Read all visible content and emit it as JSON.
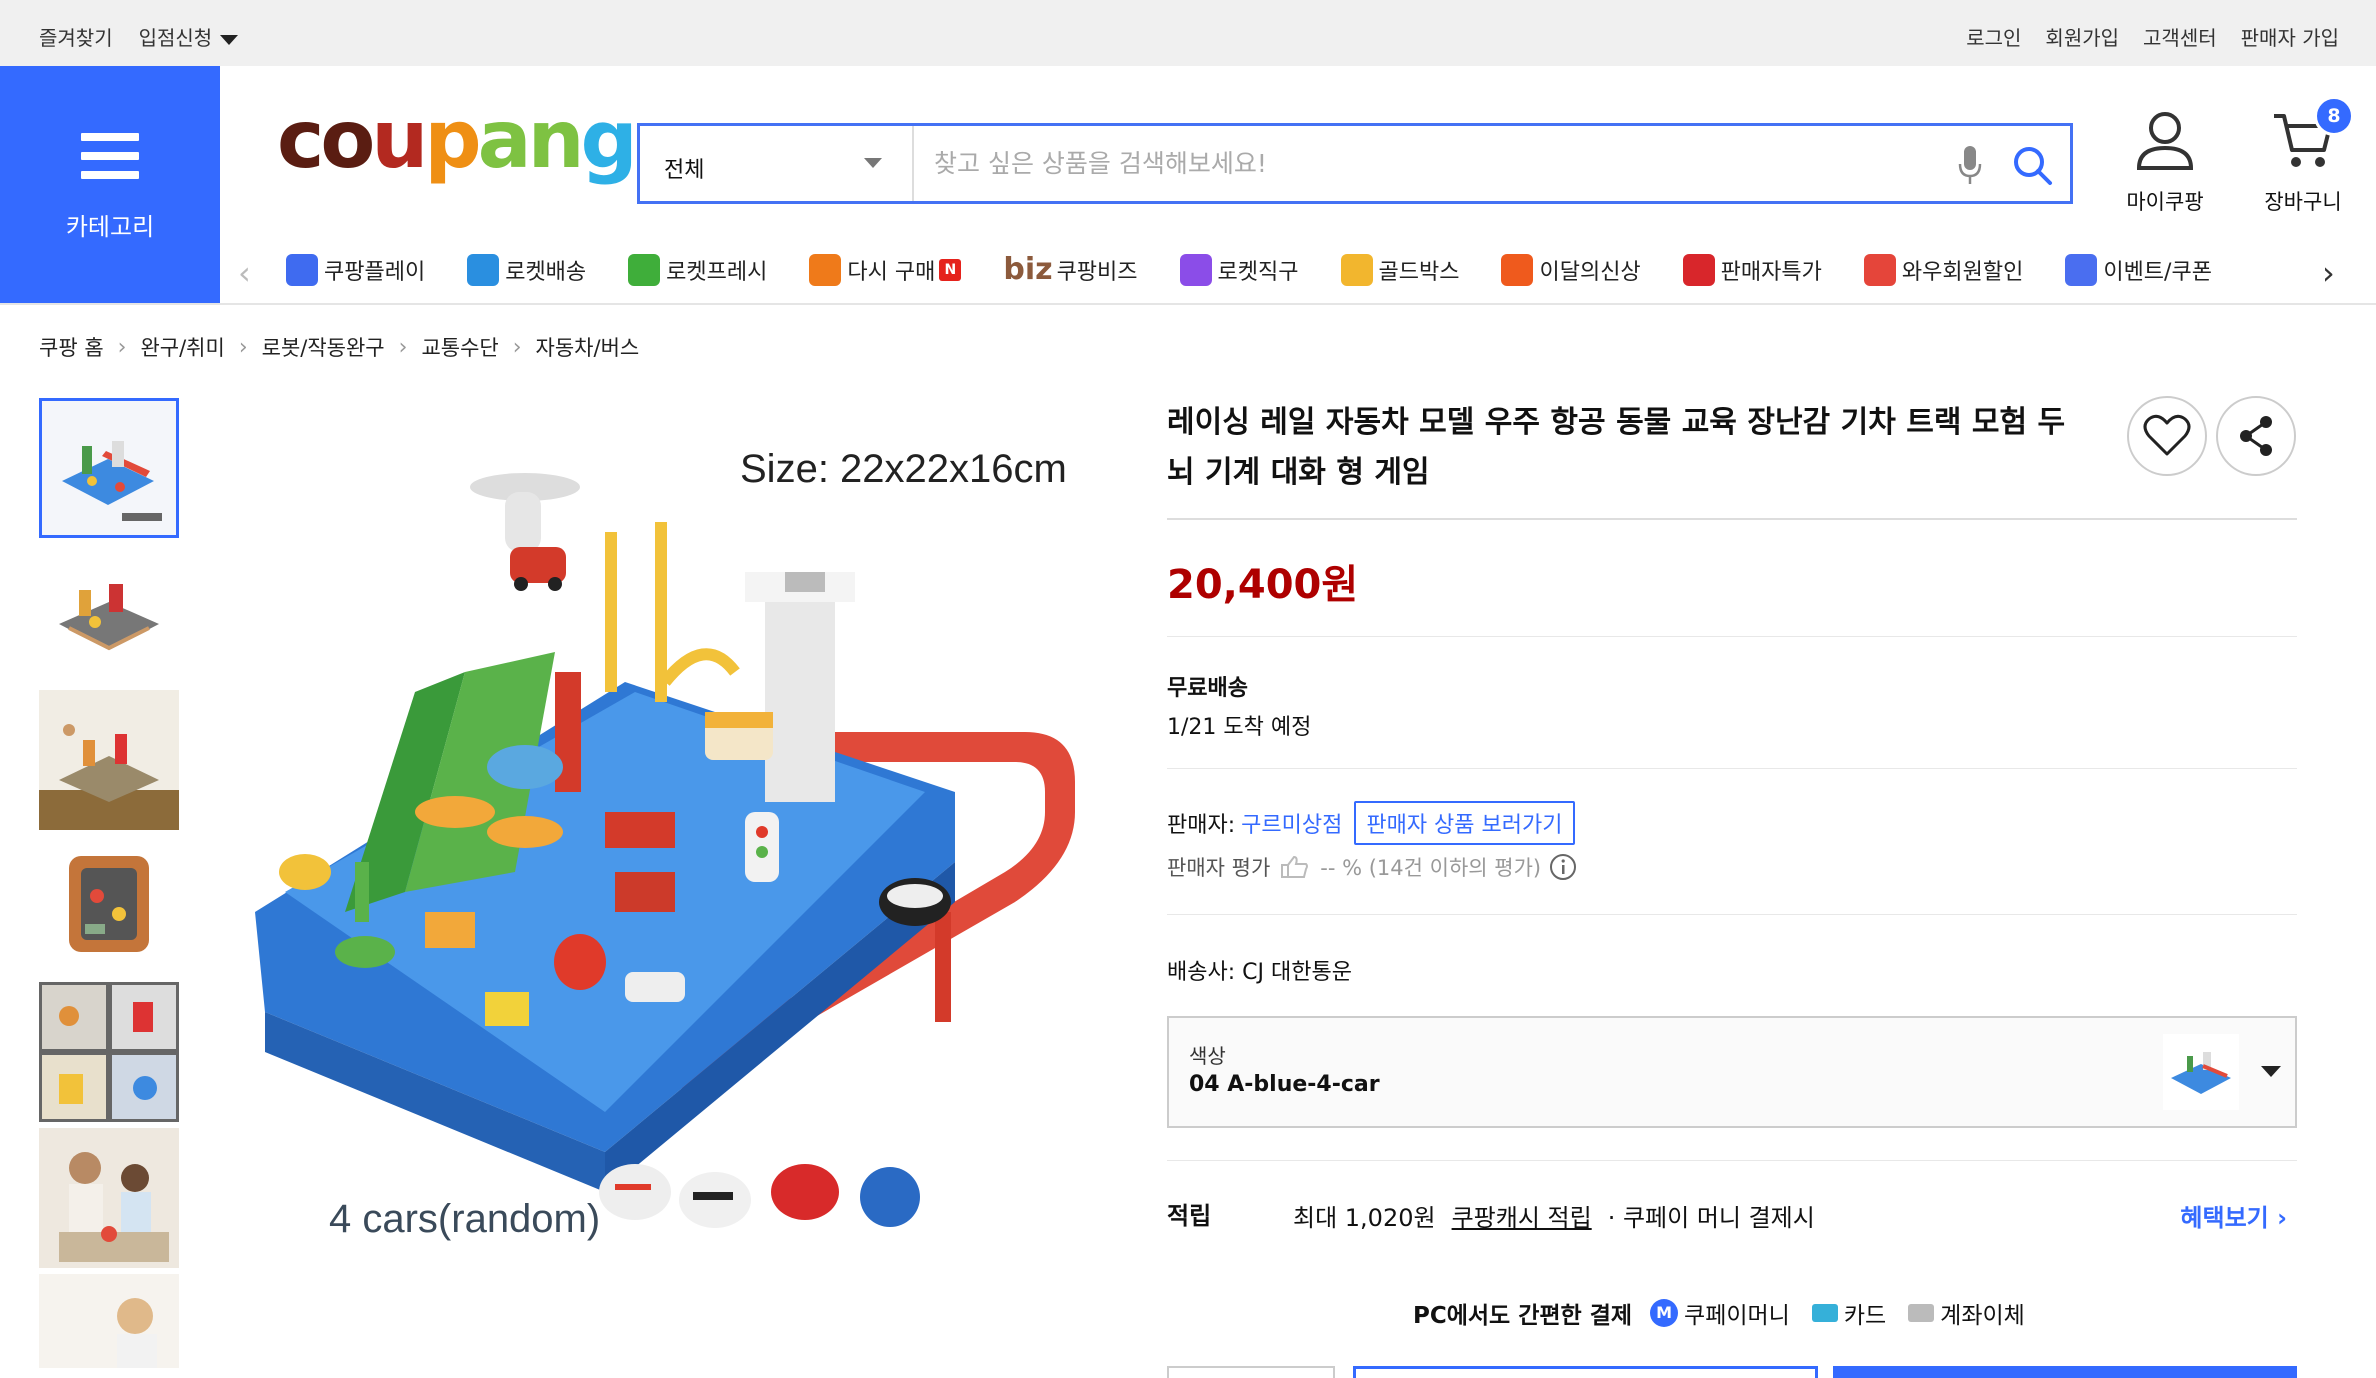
{
  "topbar": {
    "left": [
      "즐겨찾기",
      "입점신청"
    ],
    "right": [
      "로그인",
      "회원가입",
      "고객센터",
      "판매자 가입"
    ]
  },
  "category_label": "카테고리",
  "logo": {
    "c1": "co",
    "c2": "u",
    "c3": "p",
    "c4": "an",
    "c5": "g"
  },
  "search": {
    "scope": "전체",
    "placeholder": "찾고 싶은 상품을 검색해보세요!"
  },
  "header_actions": {
    "mycoupang": "마이쿠팡",
    "cart": "장바구니",
    "cart_count": "8"
  },
  "nav": {
    "items": [
      {
        "label": "쿠팡플레이",
        "icon": "play-icon",
        "color": "#3f6bf0"
      },
      {
        "label": "로켓배송",
        "icon": "rocket-icon",
        "color": "#2a8fe0"
      },
      {
        "label": "로켓프레시",
        "icon": "rocket-fresh-icon",
        "color": "#3fae3a"
      },
      {
        "label": "다시 구매",
        "icon": "rebuy-icon",
        "color": "#ef7a1a",
        "badge": "N"
      },
      {
        "label": "쿠팡비즈",
        "icon": "biz-icon",
        "prefix": "biz"
      },
      {
        "label": "로켓직구",
        "icon": "rocket-global-icon",
        "color": "#8b4de8"
      },
      {
        "label": "골드박스",
        "icon": "goldbox-icon",
        "color": "#f2b62e"
      },
      {
        "label": "이달의신상",
        "icon": "new-icon",
        "color": "#ef5a1d"
      },
      {
        "label": "판매자특가",
        "icon": "percent-icon",
        "color": "#d8262b"
      },
      {
        "label": "와우회원할인",
        "icon": "wow-icon",
        "color": "#e5453a"
      },
      {
        "label": "이벤트/쿠폰",
        "icon": "coupon-icon",
        "color": "#4a6ef0"
      }
    ]
  },
  "breadcrumb": [
    "쿠팡 홈",
    "완구/취미",
    "로봇/작동완구",
    "교통수단",
    "자동차/버스"
  ],
  "image": {
    "size_text": "Size: 22x22x16cm",
    "cars_text": "4 cars(random)"
  },
  "product": {
    "title": "레이싱 레일 자동차 모델 우주 항공 동물 교육 장난감 기차 트랙 모험 두뇌 기계 대화 형 게임",
    "price": "20,400원",
    "shipping_label": "무료배송",
    "arrival": "1/21 도착 예정",
    "seller_label": "판매자:",
    "seller_name": "구르미상점",
    "seller_button": "판매자 상품 보러가기",
    "rating_label": "판매자 평가",
    "rating_value": "-- % (14건 이하의 평가)",
    "carrier": "배송사:  CJ 대한통운",
    "option_label": "색상",
    "option_value": "04 A-blue-4-car",
    "reward_label": "적립",
    "reward_amount": "최대 1,020원",
    "reward_cash": "쿠팡캐시 적립",
    "reward_desc": "· 쿠페이 머니 결제시",
    "reward_link": "혜택보기",
    "pc_pay_label": "PC에서도 간편한 결제",
    "pay_methods": [
      "쿠페이머니",
      "카드",
      "계좌이체"
    ],
    "pay_coin": "M"
  },
  "colors": {
    "accent": "#346aff",
    "price": "#ae0000"
  }
}
